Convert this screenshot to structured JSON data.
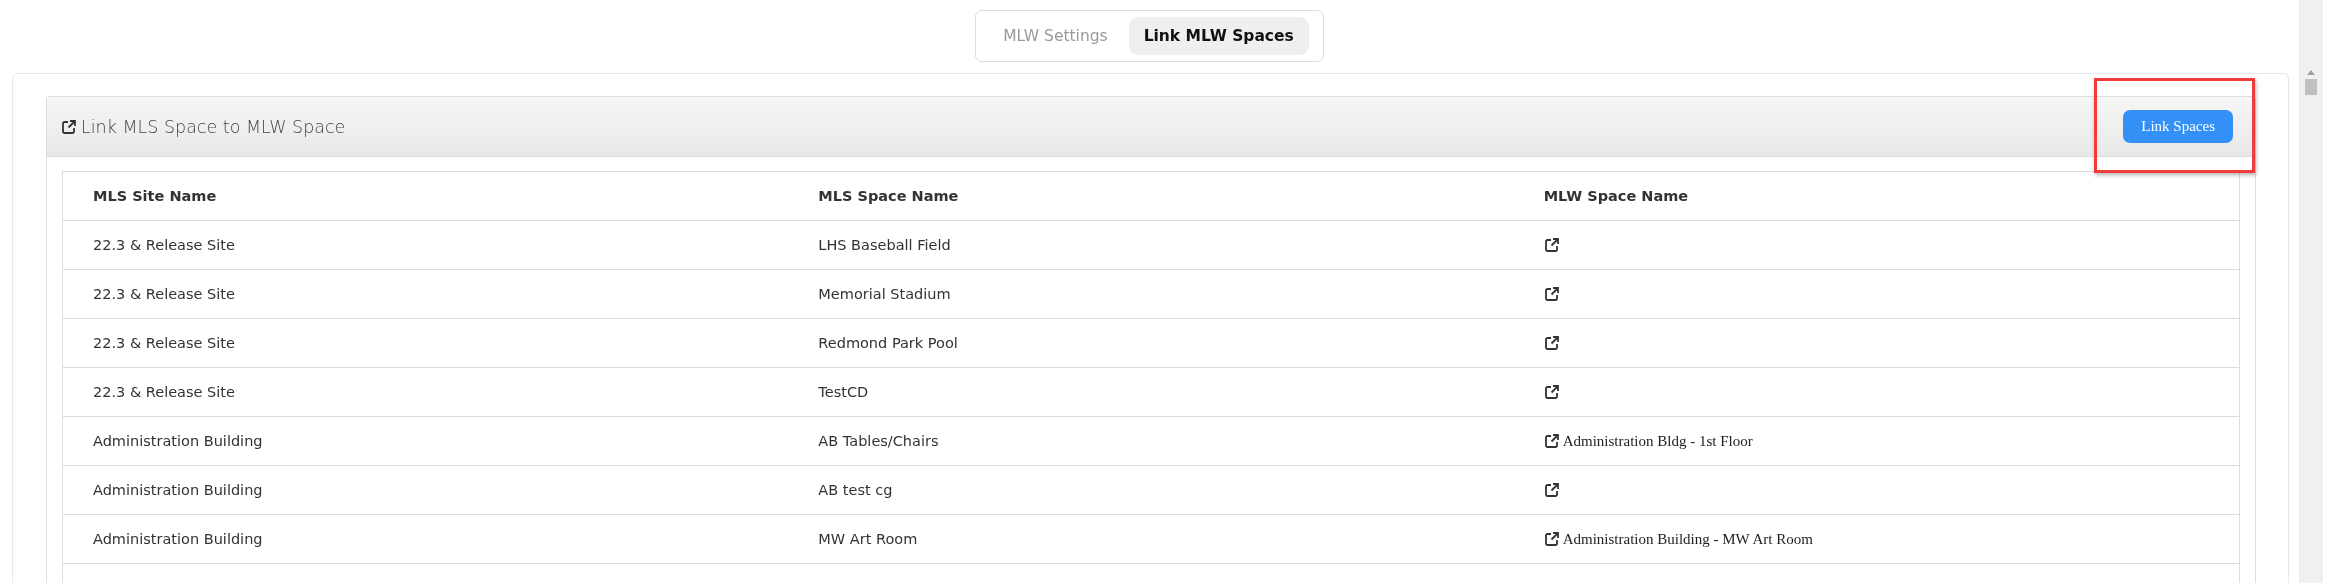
{
  "tabs": [
    {
      "label": "MLW Settings",
      "selected": false
    },
    {
      "label": "Link MLW Spaces",
      "selected": true
    }
  ],
  "panel": {
    "title": "Link MLS Space to MLW Space",
    "button": "Link Spaces",
    "button_highlighted": true
  },
  "table": {
    "columns": [
      "MLS Site Name",
      "MLS Space Name",
      "MLW Space Name"
    ],
    "rows": [
      {
        "site": "22.3 & Release Site",
        "space": "LHS Baseball Field"
      },
      {
        "site": "22.3 & Release Site",
        "space": "Memorial Stadium"
      },
      {
        "site": "22.3 & Release Site",
        "space": "Redmond Park Pool"
      },
      {
        "site": "22.3 & Release Site",
        "space": "TestCD"
      },
      {
        "site": "Administration Building",
        "space": "AB Tables/Chairs",
        "mlw_space": "Administration Bldg - 1st Floor"
      },
      {
        "site": "Administration Building",
        "space": "AB test cg"
      },
      {
        "site": "Administration Building",
        "space": "MW Art Room",
        "mlw_space": "Administration Building - MW Art Room"
      }
    ]
  }
}
